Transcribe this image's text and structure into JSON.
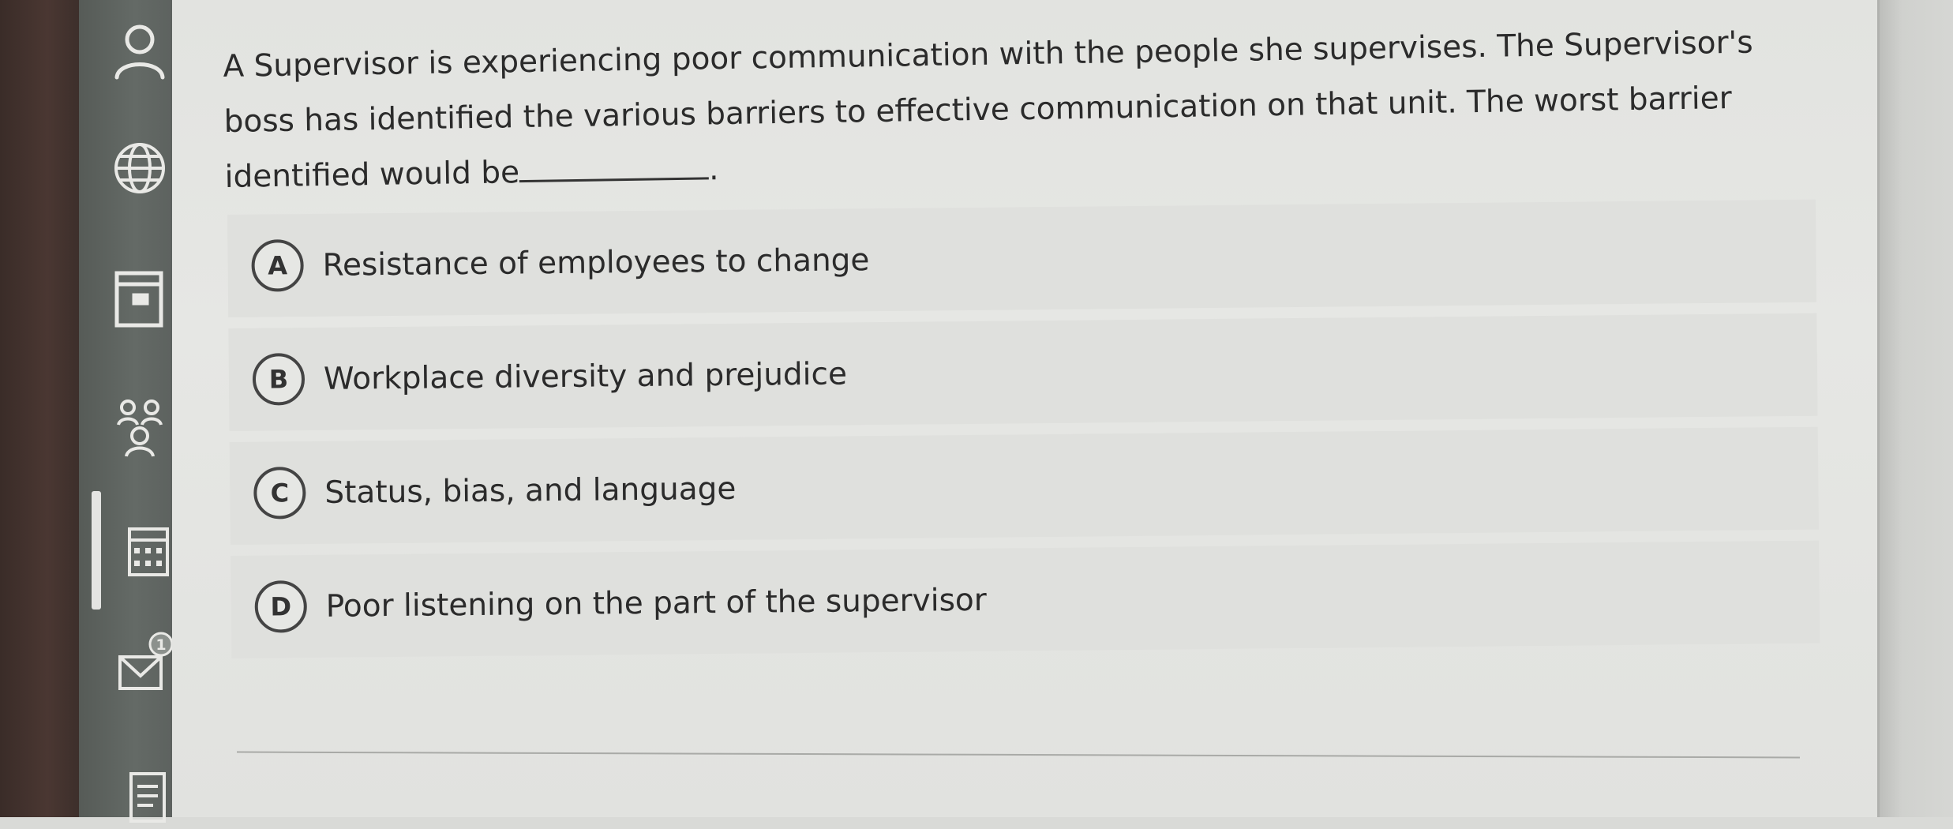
{
  "sidebar": {
    "items": [
      {
        "icon": "person-icon"
      },
      {
        "icon": "globe-icon"
      },
      {
        "icon": "book-icon"
      },
      {
        "icon": "people-icon"
      },
      {
        "icon": "calendar-icon"
      },
      {
        "icon": "mail-icon",
        "badge": "1"
      },
      {
        "icon": "document-icon"
      }
    ]
  },
  "question": {
    "text": "A Supervisor is experiencing poor communication with the people she supervises. The Supervisor's boss has identified the various barriers to effective communication on that unit. The worst barrier identified would be",
    "suffix": "."
  },
  "options": [
    {
      "letter": "A",
      "text": "Resistance of employees to change"
    },
    {
      "letter": "B",
      "text": "Workplace diversity and prejudice"
    },
    {
      "letter": "C",
      "text": "Status, bias, and language"
    },
    {
      "letter": "D",
      "text": "Poor listening on the part of the supervisor"
    }
  ]
}
